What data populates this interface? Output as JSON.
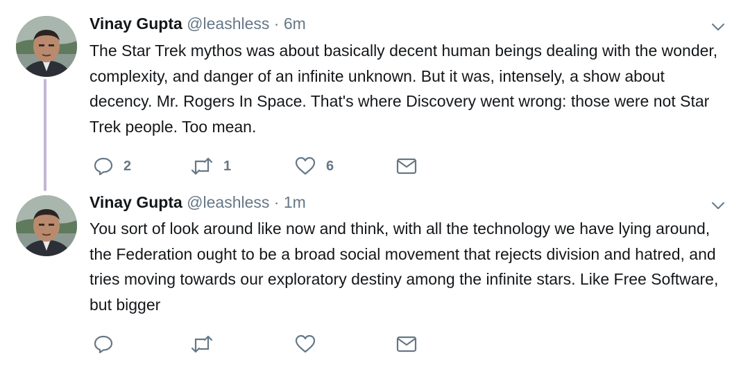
{
  "tweets": [
    {
      "name": "Vinay Gupta",
      "handle": "@leashless",
      "separator": "·",
      "time": "6m",
      "text": "The Star Trek mythos was about basically decent human beings dealing with the wonder, complexity, and danger of an infinite unknown. But it was, intensely, a show about decency. Mr. Rogers In Space. That's where Discovery went wrong: those were not Star Trek people. Too mean.",
      "replies": "2",
      "retweets": "1",
      "likes": "6"
    },
    {
      "name": "Vinay Gupta",
      "handle": "@leashless",
      "separator": "·",
      "time": "1m",
      "text": "You sort of look around like now and think, with all the technology we have lying around, the Federation ought to be a broad social movement that rejects division and hatred, and tries moving towards our exploratory destiny among the infinite stars. Like Free Software, but bigger",
      "replies": "",
      "retweets": "",
      "likes": ""
    }
  ],
  "colors": {
    "text": "#14171a",
    "secondary": "#657786",
    "thread_line": "#c4b5d6"
  },
  "icons": [
    "reply-icon",
    "retweet-icon",
    "like-icon",
    "direct-message-icon",
    "chevron-down-icon"
  ]
}
